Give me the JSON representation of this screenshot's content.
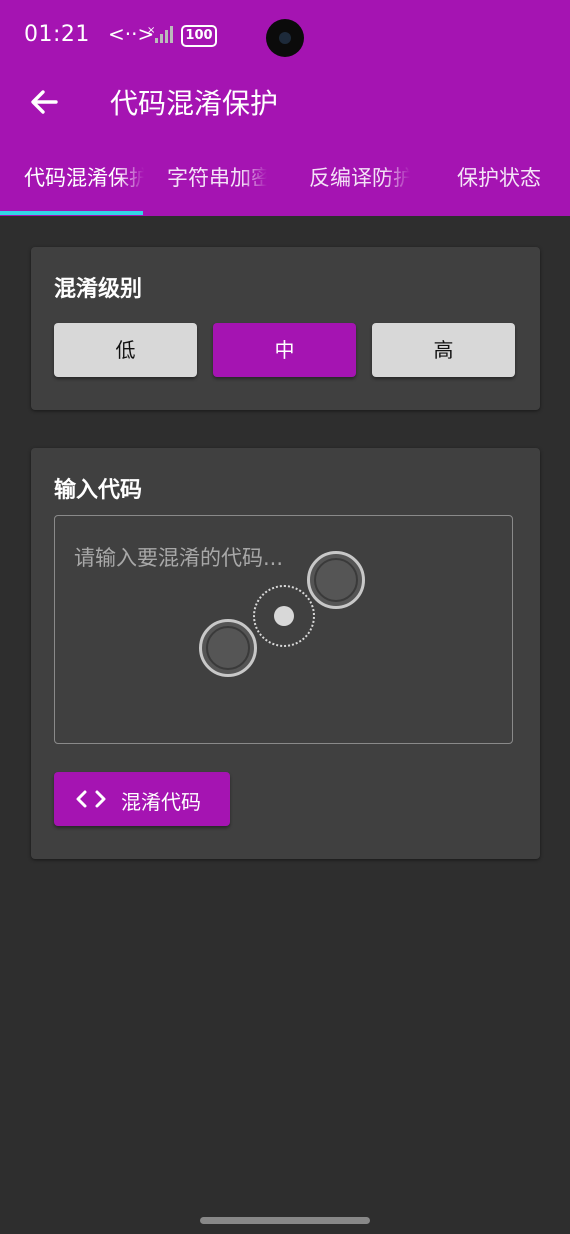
{
  "status_bar": {
    "time": "01:21",
    "battery": "100"
  },
  "toolbar": {
    "title": "代码混淆保护"
  },
  "tabs": [
    {
      "label": "代码混淆保护",
      "active": true
    },
    {
      "label": "字符串加密",
      "active": false
    },
    {
      "label": "反编译防护",
      "active": false
    },
    {
      "label": "保护状态",
      "active": false
    }
  ],
  "obfuscation_level": {
    "title": "混淆级别",
    "options": [
      "低",
      "中",
      "高"
    ],
    "selected": "中"
  },
  "code_input": {
    "title": "输入代码",
    "placeholder": "请输入要混淆的代码...",
    "value": ""
  },
  "obfuscate_button": {
    "label": "混淆代码",
    "icon": "code-icon"
  },
  "colors": {
    "primary": "#a514b2",
    "tab_indicator": "#33d6e6",
    "background": "#2e2e2e",
    "card": "#404040"
  }
}
